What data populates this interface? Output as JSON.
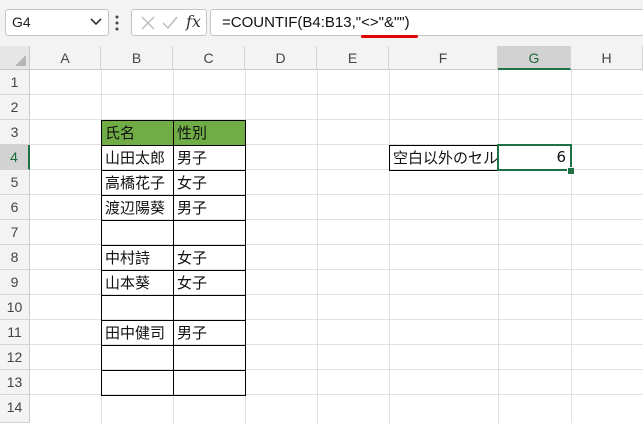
{
  "name_box": {
    "value": "G4"
  },
  "formula_bar": {
    "formula": "=COUNTIF(B4:B13,\"<>\"&\"\")",
    "fx_label": "fx"
  },
  "columns": [
    "A",
    "B",
    "C",
    "D",
    "E",
    "F",
    "G",
    "H"
  ],
  "rows": [
    "1",
    "2",
    "3",
    "4",
    "5",
    "6",
    "7",
    "8",
    "9",
    "10",
    "11",
    "12",
    "13",
    "14"
  ],
  "selected": {
    "column": "G",
    "row": "4"
  },
  "table": {
    "headers": [
      "氏名",
      "性別"
    ],
    "rows": [
      [
        "山田太郎",
        "男子"
      ],
      [
        "高橋花子",
        "女子"
      ],
      [
        "渡辺陽葵",
        "男子"
      ],
      [
        "",
        ""
      ],
      [
        "中村詩",
        "女子"
      ],
      [
        "山本葵",
        "女子"
      ],
      [
        "",
        ""
      ],
      [
        "田中健司",
        "男子"
      ],
      [
        "",
        ""
      ],
      [
        "",
        ""
      ]
    ]
  },
  "cells": {
    "F4": "空白以外のセル",
    "G4": "6"
  },
  "colors": {
    "header_fill": "#70ad47",
    "selection": "#1e7145",
    "annotation_underline": "#e00000"
  }
}
